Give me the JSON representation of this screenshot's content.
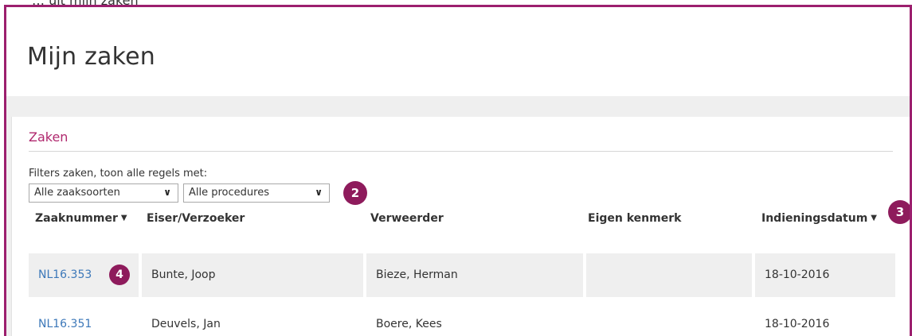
{
  "top_cut_text": "… uit mijn zaken",
  "page_title": "Mijn zaken",
  "section_title": "Zaken",
  "filters": {
    "label": "Filters zaken, toon alle regels met:",
    "case_type": "Alle zaaksoorten",
    "procedure": "Alle procedures"
  },
  "columns": {
    "zaaknummer": "Zaaknummer",
    "eiser": "Eiser/Verzoeker",
    "verweerder": "Verweerder",
    "kenmerk": "Eigen kenmerk",
    "datum": "Indieningsdatum"
  },
  "rows": [
    {
      "zaaknummer": "NL16.353",
      "eiser": "Bunte, Joop",
      "verweerder": "Bieze, Herman",
      "kenmerk": "",
      "datum": "18-10-2016"
    },
    {
      "zaaknummer": "NL16.351",
      "eiser": "Deuvels, Jan",
      "verweerder": "Boere, Kees",
      "kenmerk": "",
      "datum": "18-10-2016"
    }
  ],
  "badges": {
    "filter": "2",
    "sort": "3",
    "case": "4"
  },
  "colors": {
    "accent": "#9c1f6e",
    "badge": "#8e1b5c",
    "link": "#3c78b9"
  }
}
